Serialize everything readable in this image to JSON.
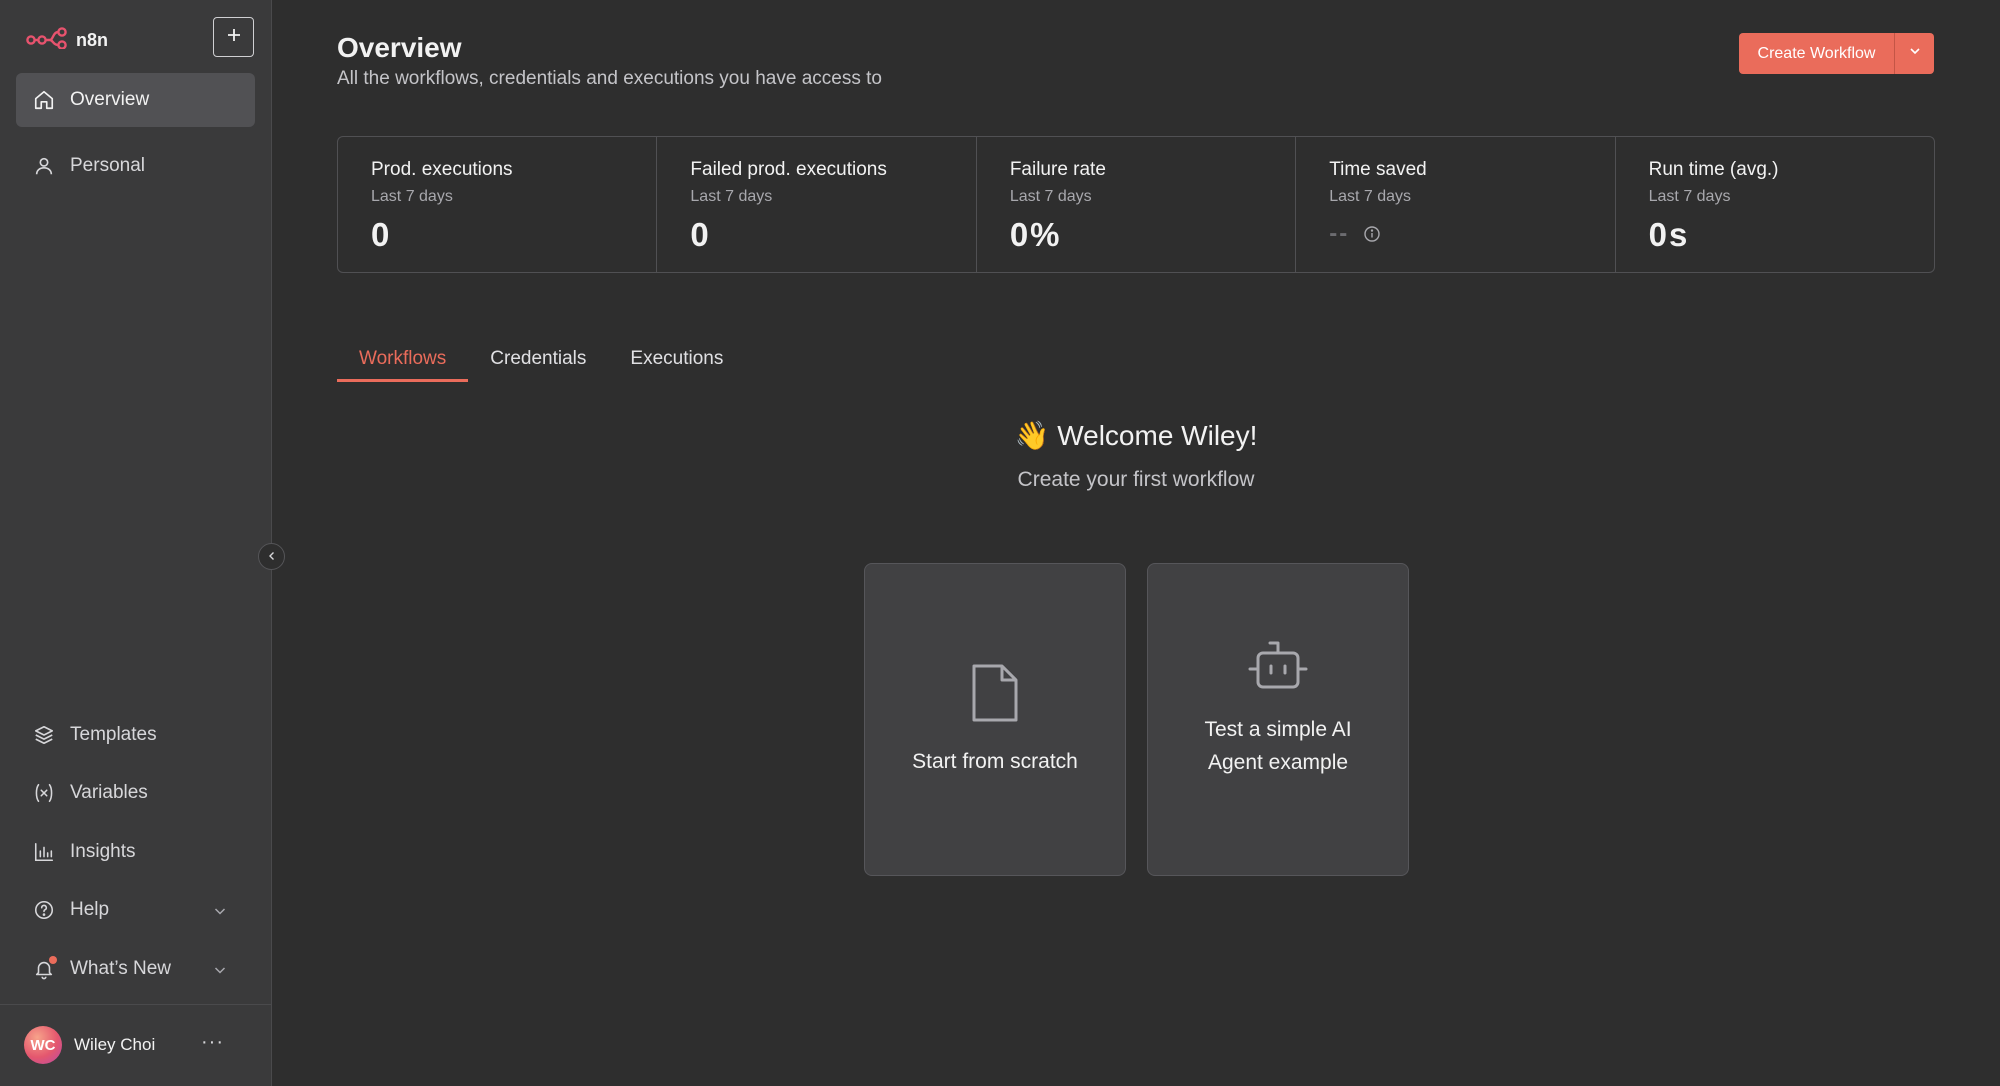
{
  "app": {
    "logo_text": "n8n",
    "accent_color": "#ea6c5b"
  },
  "sidebar": {
    "new_button_icon": "plus-icon",
    "top_items": [
      {
        "label": "Overview",
        "icon": "home-icon",
        "active": true
      },
      {
        "label": "Personal",
        "icon": "user-icon",
        "active": false
      }
    ],
    "bottom_items": [
      {
        "label": "Templates",
        "icon": "box-icon"
      },
      {
        "label": "Variables",
        "icon": "variable-icon"
      },
      {
        "label": "Insights",
        "icon": "bar-chart-icon"
      },
      {
        "label": "Help",
        "icon": "help-circle-icon"
      },
      {
        "label": "What’s New",
        "icon": "bell-icon"
      }
    ],
    "user": {
      "initials": "WC",
      "name": "Wiley Choi",
      "menu": "···"
    }
  },
  "header": {
    "title": "Overview",
    "subtitle": "All the workflows, credentials and executions you have access to",
    "create_label": "Create Workflow"
  },
  "stats": [
    {
      "label": "Prod. executions",
      "period": "Last 7 days",
      "value": "0"
    },
    {
      "label": "Failed prod. executions",
      "period": "Last 7 days",
      "value": "0"
    },
    {
      "label": "Failure rate",
      "period": "Last 7 days",
      "value": "0%"
    },
    {
      "label": "Time saved",
      "period": "Last 7 days",
      "value": "--"
    },
    {
      "label": "Run time (avg.)",
      "period": "Last 7 days",
      "value": "0s"
    }
  ],
  "tabs": [
    {
      "label": "Workflows",
      "active": true
    },
    {
      "label": "Credentials",
      "active": false
    },
    {
      "label": "Executions",
      "active": false
    }
  ],
  "welcome": {
    "title": "👋 Welcome Wiley!",
    "subtitle": "Create your first workflow"
  },
  "cards": [
    {
      "label": "Start from scratch",
      "icon": "file-icon"
    },
    {
      "label": "Test a simple AI Agent example",
      "icon": "bot-icon"
    }
  ]
}
